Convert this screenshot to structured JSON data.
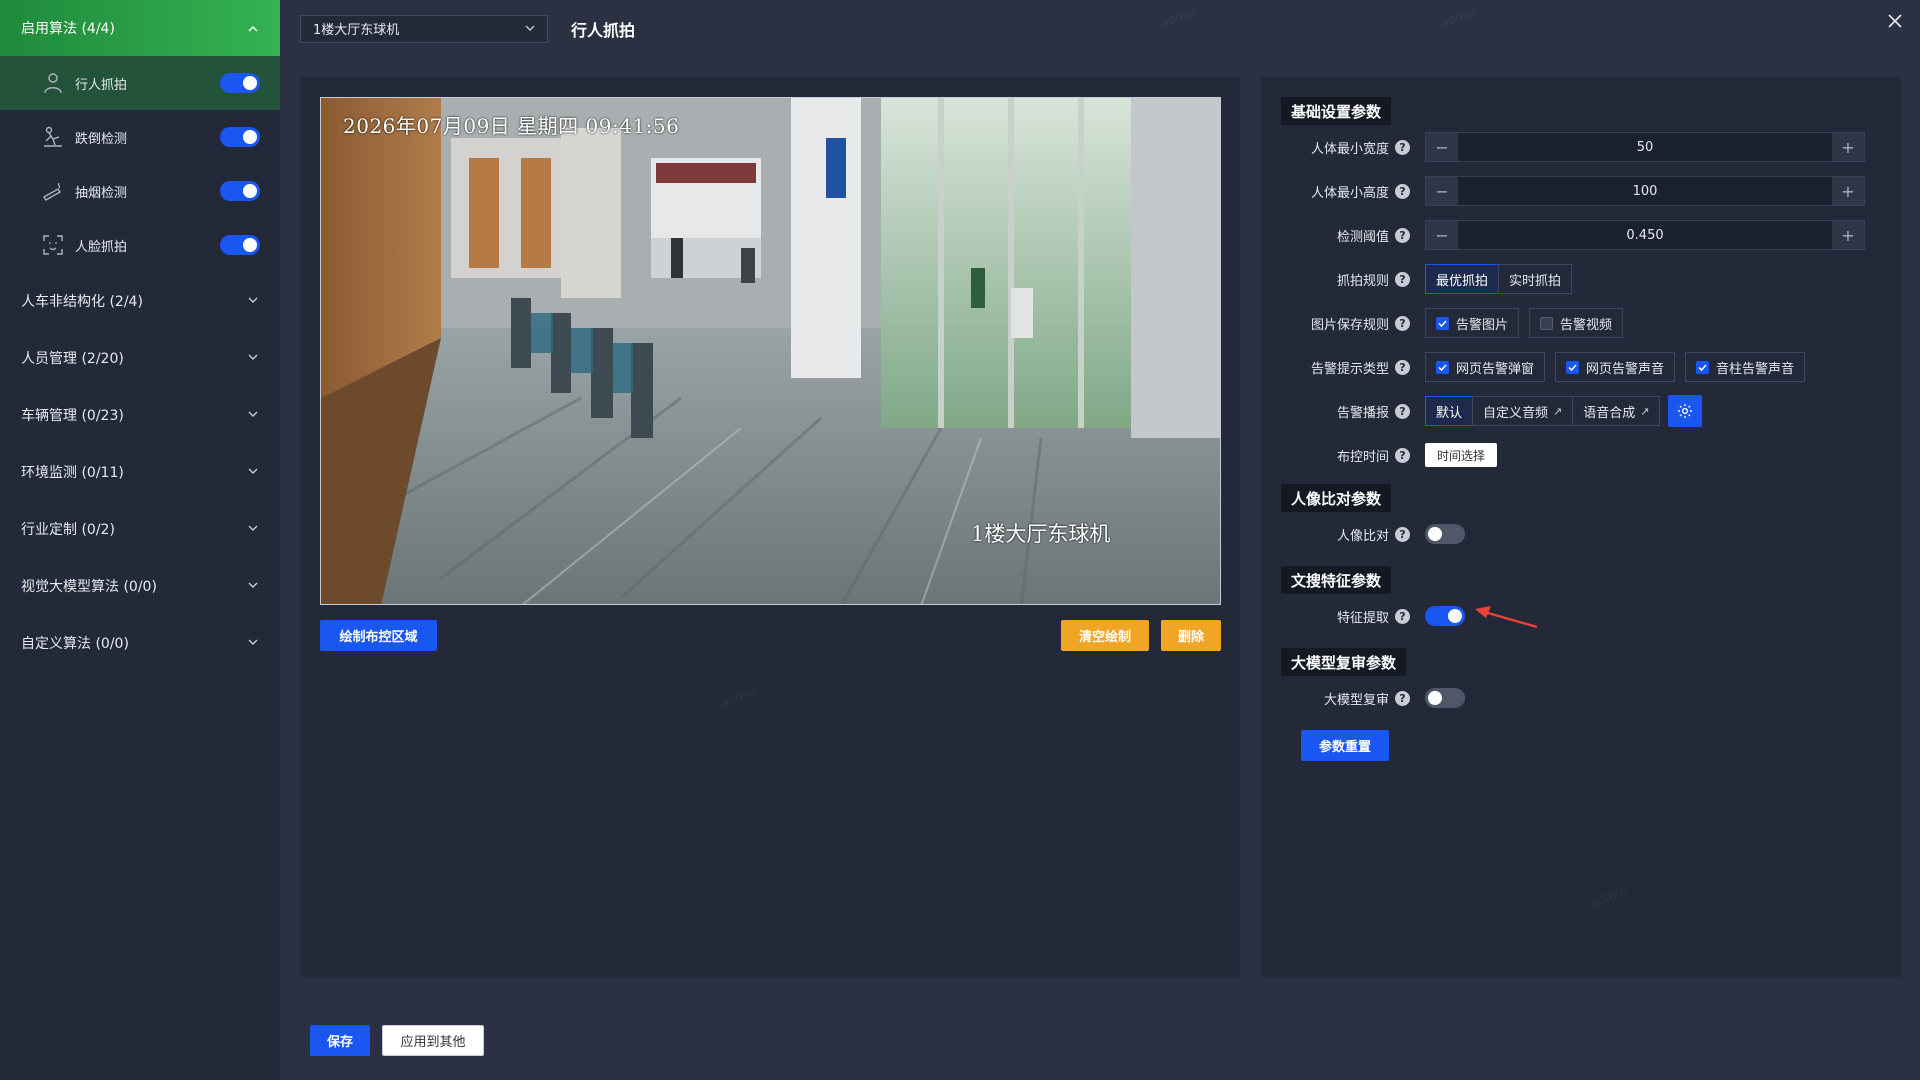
{
  "sidebar": {
    "enabled_group": {
      "label": "启用算法 (4/4)"
    },
    "algorithms": [
      {
        "label": "行人抓拍",
        "icon": "pedestrian-icon",
        "enabled": true
      },
      {
        "label": "跌倒检测",
        "icon": "fall-icon",
        "enabled": true
      },
      {
        "label": "抽烟检测",
        "icon": "smoking-icon",
        "enabled": true
      },
      {
        "label": "人脸抓拍",
        "icon": "face-icon",
        "enabled": true
      }
    ],
    "groups": [
      {
        "label": "人车非结构化 (2/4)"
      },
      {
        "label": "人员管理 (2/20)"
      },
      {
        "label": "车辆管理 (0/23)"
      },
      {
        "label": "环境监测 (0/11)"
      },
      {
        "label": "行业定制 (0/2)"
      },
      {
        "label": "视觉大模型算法 (0/0)"
      },
      {
        "label": "自定义算法 (0/0)"
      }
    ]
  },
  "header": {
    "device": "1楼大厅东球机",
    "title": "行人抓拍"
  },
  "video": {
    "osd_time": "2026年07月09日  星期四  09:41:56",
    "osd_name": "1楼大厅东球机",
    "draw_label": "绘制布控区域",
    "clear_label": "清空绘制",
    "delete_label": "删除"
  },
  "settings": {
    "basic_title": "基础设置参数",
    "min_width": {
      "label": "人体最小宽度",
      "value": "50"
    },
    "min_height": {
      "label": "人体最小高度",
      "value": "100"
    },
    "threshold": {
      "label": "检测阈值",
      "value": "0.450"
    },
    "capture_rule": {
      "label": "抓拍规则",
      "options": [
        "最优抓拍",
        "实时抓拍"
      ],
      "selected": "最优抓拍"
    },
    "save_rule": {
      "label": "图片保存规则",
      "options": [
        {
          "text": "告警图片",
          "checked": true
        },
        {
          "text": "告警视频",
          "checked": false
        }
      ]
    },
    "alarm_type": {
      "label": "告警提示类型",
      "options": [
        {
          "text": "网页告警弹窗",
          "checked": true
        },
        {
          "text": "网页告警声音",
          "checked": true
        },
        {
          "text": "音柱告警声音",
          "checked": true
        }
      ]
    },
    "broadcast": {
      "label": "告警播报",
      "options": [
        "默认",
        "自定义音频",
        "语音合成"
      ],
      "selected": "默认"
    },
    "schedule": {
      "label": "布控时间",
      "button": "时间选择"
    },
    "face_title": "人像比对参数",
    "face_compare": {
      "label": "人像比对",
      "enabled": false
    },
    "feature_title": "文搜特征参数",
    "feature_extract": {
      "label": "特征提取",
      "enabled": true
    },
    "llm_title": "大模型复审参数",
    "llm_review": {
      "label": "大模型复审",
      "enabled": false
    },
    "reset_label": "参数重置",
    "help_symbol": "?"
  },
  "footer": {
    "save_label": "保存",
    "apply_label": "应用到其他"
  },
  "watermark": "admin",
  "colors": {
    "accent": "#1a56f0",
    "active_group": "#34b254",
    "warning": "#f0a524",
    "annotation_arrow": "#e8443a"
  }
}
